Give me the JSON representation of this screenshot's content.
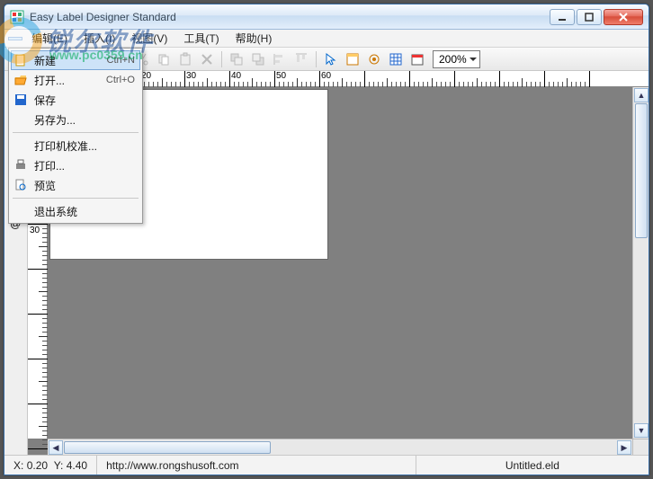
{
  "window": {
    "title": "Easy Label Designer Standard"
  },
  "watermark": {
    "brand": "锐尔软件",
    "url": "www.pc0359.cn"
  },
  "menubar": [
    {
      "id": "file",
      "label": ""
    },
    {
      "id": "edit",
      "label": "编辑(E)"
    },
    {
      "id": "insert",
      "label": "插入(I)"
    },
    {
      "id": "view",
      "label": "视图(V)"
    },
    {
      "id": "tool",
      "label": "工具(T)"
    },
    {
      "id": "help",
      "label": "帮助(H)"
    }
  ],
  "file_menu": {
    "items": [
      {
        "id": "new",
        "label": "新建",
        "accel": "Ctrl+N",
        "icon": "new"
      },
      {
        "id": "open",
        "label": "打开...",
        "accel": "Ctrl+O",
        "icon": "open"
      },
      {
        "id": "save",
        "label": "保存",
        "accel": "",
        "icon": "save"
      },
      {
        "id": "saveas",
        "label": "另存为...",
        "accel": "",
        "icon": ""
      },
      {
        "sep": true
      },
      {
        "id": "calib",
        "label": "打印机校准...",
        "accel": "",
        "icon": ""
      },
      {
        "id": "print",
        "label": "打印...",
        "accel": "",
        "icon": "print"
      },
      {
        "id": "preview",
        "label": "预览",
        "accel": "",
        "icon": "preview"
      },
      {
        "sep": true
      },
      {
        "id": "exit",
        "label": "退出系统",
        "accel": "",
        "icon": ""
      }
    ],
    "selected_id": "new"
  },
  "toolbar": {
    "zoom": "200%"
  },
  "ruler": {
    "h_max": 60,
    "v_max": 30,
    "major_step": 10
  },
  "status": {
    "coord_label_x": "X:",
    "coord_x": "0.20",
    "coord_label_y": "Y:",
    "coord_y": "4.40",
    "url": "http://www.rongshusoft.com",
    "filename": "Untitled.eld"
  }
}
